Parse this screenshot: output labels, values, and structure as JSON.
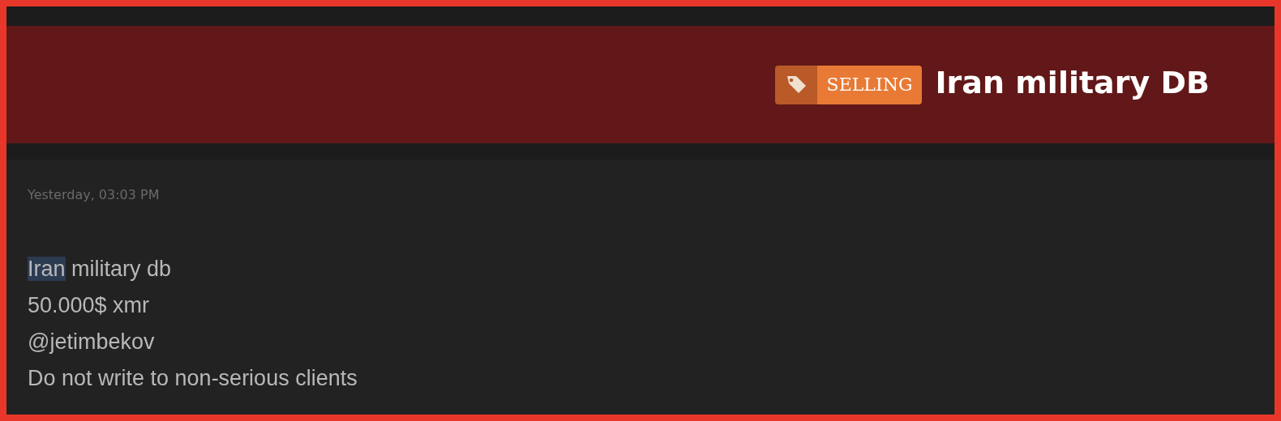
{
  "thread": {
    "prefix": "SELLING",
    "title": "Iran military DB"
  },
  "post": {
    "timestamp": "Yesterday, 03:03 PM",
    "lines": [
      {
        "segments": [
          {
            "text": "Iran",
            "selected": true
          },
          {
            "text": " military db",
            "selected": false
          }
        ]
      },
      {
        "segments": [
          {
            "text": "50.000$ xmr",
            "selected": false
          }
        ]
      },
      {
        "segments": [
          {
            "text": "@jetimbekov",
            "selected": false
          }
        ]
      },
      {
        "segments": [
          {
            "text": "Do not write to non-serious clients",
            "selected": false
          }
        ]
      }
    ]
  }
}
